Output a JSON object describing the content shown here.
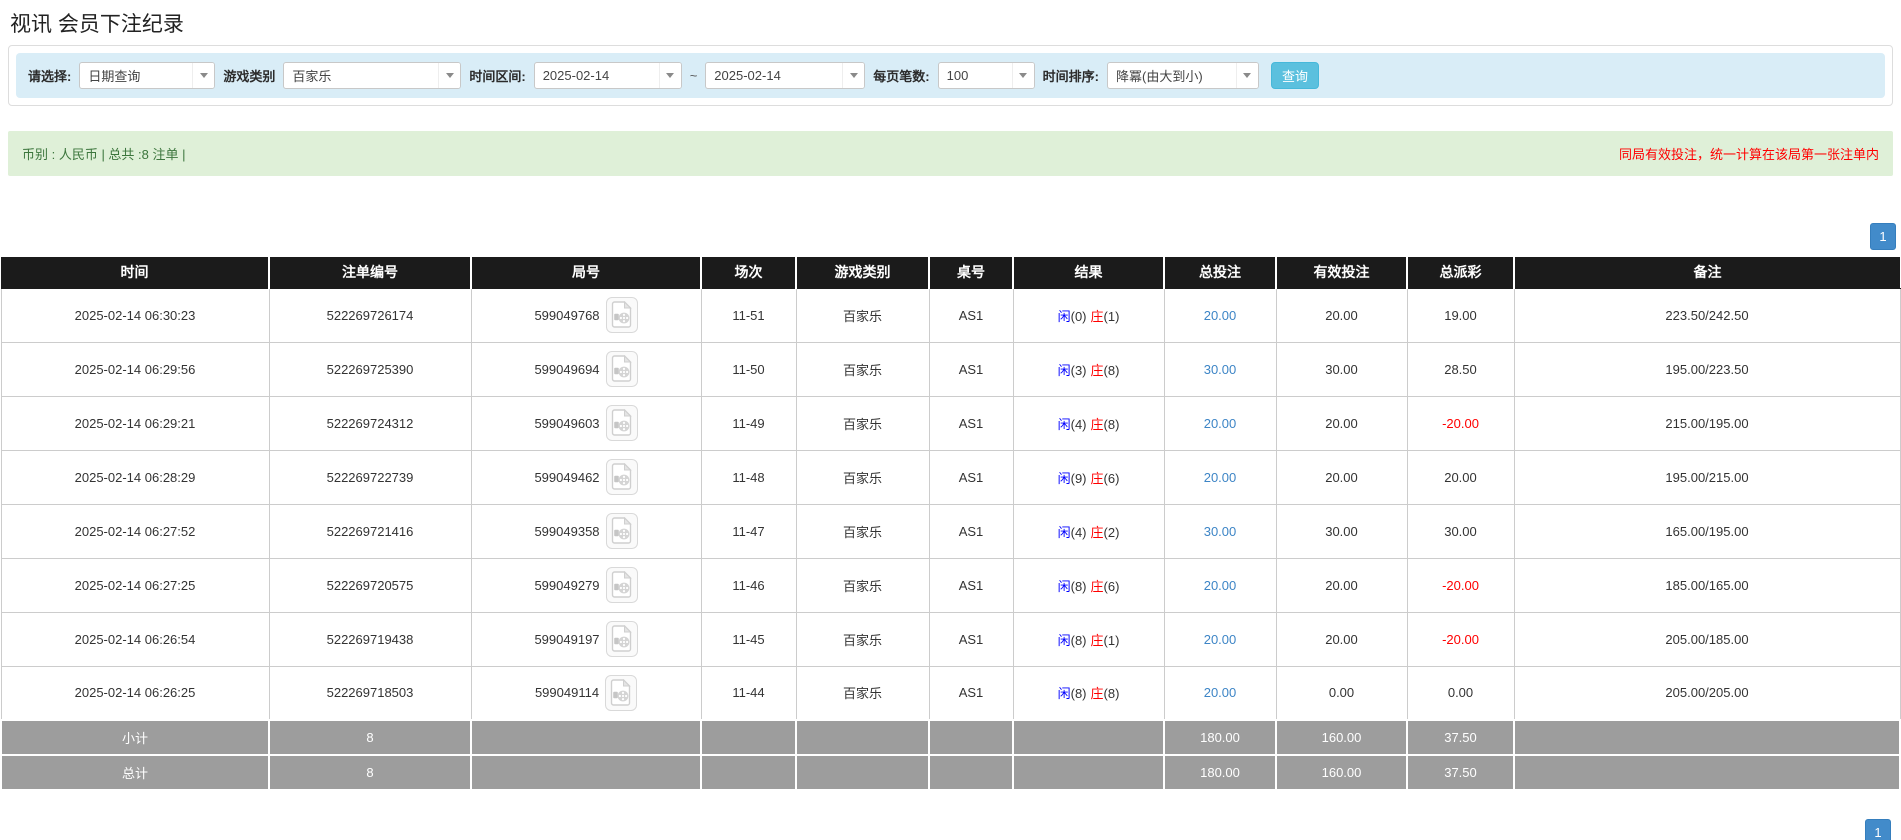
{
  "title": "视讯 会员下注纪录",
  "filters": {
    "select_label": "请选择:",
    "select_value": "日期查询",
    "game_category_label": "游戏类别",
    "game_category_value": "百家乐",
    "time_range_label": "时间区间:",
    "date_from": "2025-02-14",
    "range_separator": "~",
    "date_to": "2025-02-14",
    "page_size_label": "每页笔数:",
    "page_size_value": "100",
    "time_sort_label": "时间排序:",
    "time_sort_value": "降冪(由大到小)",
    "search_button": "查询"
  },
  "summary_bar": {
    "left_text": "币别 : 人民币 | 总共 :8 注单 |",
    "right_notice": "同局有效投注，统一计算在该局第一张注单内"
  },
  "pagination": {
    "page": "1"
  },
  "table": {
    "columns": [
      "时间",
      "注单编号",
      "局号",
      "场次",
      "游戏类别",
      "桌号",
      "结果",
      "总投注",
      "有效投注",
      "总派彩",
      "备注"
    ],
    "result_labels": {
      "player": "闲",
      "banker": "庄"
    },
    "rows": [
      {
        "time": "2025-02-14 06:30:23",
        "bet_id": "522269726174",
        "round_no": "599049768",
        "session": "11-51",
        "game": "百家乐",
        "table_no": "AS1",
        "result": {
          "player": "0",
          "banker": "1"
        },
        "total_bet": "20.00",
        "valid_bet": "20.00",
        "payout": "19.00",
        "remark": "223.50/242.50"
      },
      {
        "time": "2025-02-14 06:29:56",
        "bet_id": "522269725390",
        "round_no": "599049694",
        "session": "11-50",
        "game": "百家乐",
        "table_no": "AS1",
        "result": {
          "player": "3",
          "banker": "8"
        },
        "total_bet": "30.00",
        "valid_bet": "30.00",
        "payout": "28.50",
        "remark": "195.00/223.50"
      },
      {
        "time": "2025-02-14 06:29:21",
        "bet_id": "522269724312",
        "round_no": "599049603",
        "session": "11-49",
        "game": "百家乐",
        "table_no": "AS1",
        "result": {
          "player": "4",
          "banker": "8"
        },
        "total_bet": "20.00",
        "valid_bet": "20.00",
        "payout": "-20.00",
        "remark": "215.00/195.00"
      },
      {
        "time": "2025-02-14 06:28:29",
        "bet_id": "522269722739",
        "round_no": "599049462",
        "session": "11-48",
        "game": "百家乐",
        "table_no": "AS1",
        "result": {
          "player": "9",
          "banker": "6"
        },
        "total_bet": "20.00",
        "valid_bet": "20.00",
        "payout": "20.00",
        "remark": "195.00/215.00"
      },
      {
        "time": "2025-02-14 06:27:52",
        "bet_id": "522269721416",
        "round_no": "599049358",
        "session": "11-47",
        "game": "百家乐",
        "table_no": "AS1",
        "result": {
          "player": "4",
          "banker": "2"
        },
        "total_bet": "30.00",
        "valid_bet": "30.00",
        "payout": "30.00",
        "remark": "165.00/195.00"
      },
      {
        "time": "2025-02-14 06:27:25",
        "bet_id": "522269720575",
        "round_no": "599049279",
        "session": "11-46",
        "game": "百家乐",
        "table_no": "AS1",
        "result": {
          "player": "8",
          "banker": "6"
        },
        "total_bet": "20.00",
        "valid_bet": "20.00",
        "payout": "-20.00",
        "remark": "185.00/165.00"
      },
      {
        "time": "2025-02-14 06:26:54",
        "bet_id": "522269719438",
        "round_no": "599049197",
        "session": "11-45",
        "game": "百家乐",
        "table_no": "AS1",
        "result": {
          "player": "8",
          "banker": "1"
        },
        "total_bet": "20.00",
        "valid_bet": "20.00",
        "payout": "-20.00",
        "remark": "205.00/185.00"
      },
      {
        "time": "2025-02-14 06:26:25",
        "bet_id": "522269718503",
        "round_no": "599049114",
        "session": "11-44",
        "game": "百家乐",
        "table_no": "AS1",
        "result": {
          "player": "8",
          "banker": "8"
        },
        "total_bet": "20.00",
        "valid_bet": "0.00",
        "payout": "0.00",
        "remark": "205.00/205.00"
      }
    ],
    "subtotal": {
      "label": "小计",
      "count": "8",
      "total_bet": "180.00",
      "valid_bet": "160.00",
      "payout": "37.50"
    },
    "total": {
      "label": "总计",
      "count": "8",
      "total_bet": "180.00",
      "valid_bet": "160.00",
      "payout": "37.50"
    }
  },
  "colors": {
    "accent_blue": "#5bc0de",
    "pagination_blue": "#428bca",
    "link_blue": "#3d85c6",
    "player_blue": "#0000ff",
    "banker_red": "#ff0000",
    "negative_red": "#ff0000",
    "header_bg": "#1b1b1b",
    "footer_bg": "#9d9d9d",
    "filter_bg": "#d9edf7",
    "summary_bg": "#dff0d8",
    "summary_text": "#3c763d"
  }
}
